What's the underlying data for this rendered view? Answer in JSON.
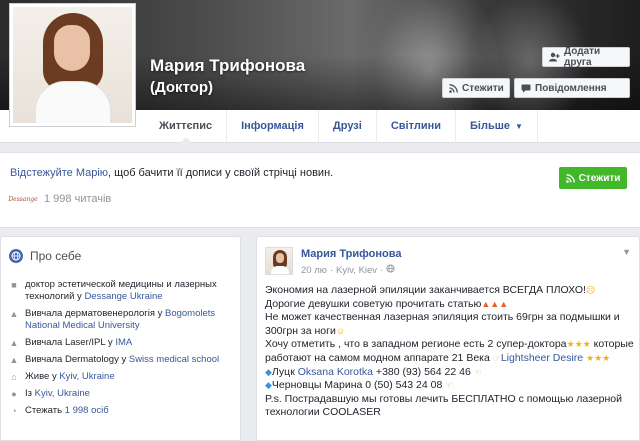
{
  "profile": {
    "name": "Мария Трифонова",
    "subtitle": "(Доктор)"
  },
  "cover_buttons": {
    "add_friend": "Додати друга",
    "follow": "Стежити",
    "message": "Повідомлення"
  },
  "tabs": [
    {
      "label": "Життєпис",
      "active": true
    },
    {
      "label": "Інформація"
    },
    {
      "label": "Друзі"
    },
    {
      "label": "Світлини"
    },
    {
      "label": "Більше"
    }
  ],
  "prompt": {
    "link": "Відстежуйте Марію",
    "text": ", щоб бачити її дописи у своїй стрічці новин.",
    "follow_button": "Стежити",
    "readers": "1 998 читачів",
    "logo_text": "Dessange"
  },
  "about": {
    "title": "Про себе",
    "items": [
      {
        "icon": "briefcase-icon",
        "text": "доктор эстетической медицины и лазерных технологий у ",
        "link": "Dessange Ukraine"
      },
      {
        "icon": "graduation-cap-icon",
        "text": "Вивчала дерматовенерологія у ",
        "link": "Bogomolets National Medical University"
      },
      {
        "icon": "graduation-cap-icon",
        "text": "Вивчала Laser/IPL у ",
        "link": "IMA"
      },
      {
        "icon": "graduation-cap-icon",
        "text": "Вивчала Dermatology у ",
        "link": "Swiss medical school"
      },
      {
        "icon": "home-icon",
        "text": "Живе у ",
        "link": "Kyiv, Ukraine"
      },
      {
        "icon": "location-pin-icon",
        "text": "Із ",
        "link": "Kyiv, Ukraine"
      },
      {
        "icon": "rss-icon",
        "text": "Стежать ",
        "link": "1 998 осіб"
      }
    ]
  },
  "post": {
    "author": "Мария Трифонова",
    "date": "20 лю",
    "place": "Kyiv, Kiev",
    "lines": {
      "l1": "Экономия на лазерной эпиляции заканчивается ВСЕГДА ПЛОХО!",
      "l2": "Дорогие девушки советую прочитать статью",
      "l3": "Не может качественная лазерная эпиляция стоить 69грн за подмышки и 300грн за ноги",
      "l4a": "Хочу отметить , что в западном регионе есть 2 супер-доктора",
      "l4b": "которые работают на самом модном аппарате 21 Века",
      "l4link": "Lightsheer Desire",
      "l5name": "Луцк ",
      "l5link": "Oksana Korotka",
      "l5phone": " +380 (93) 564 22 46",
      "l6": "Черновцы Марина 0 (50) 543 24 08",
      "l7": "P.s. Пострадавшую мы готовы лечить БЕСПЛАТНО с помощью лазерной технологии COOLASER"
    }
  },
  "colors": {
    "link": "#365899",
    "green": "#42b72a",
    "background": "#e9ebee"
  }
}
